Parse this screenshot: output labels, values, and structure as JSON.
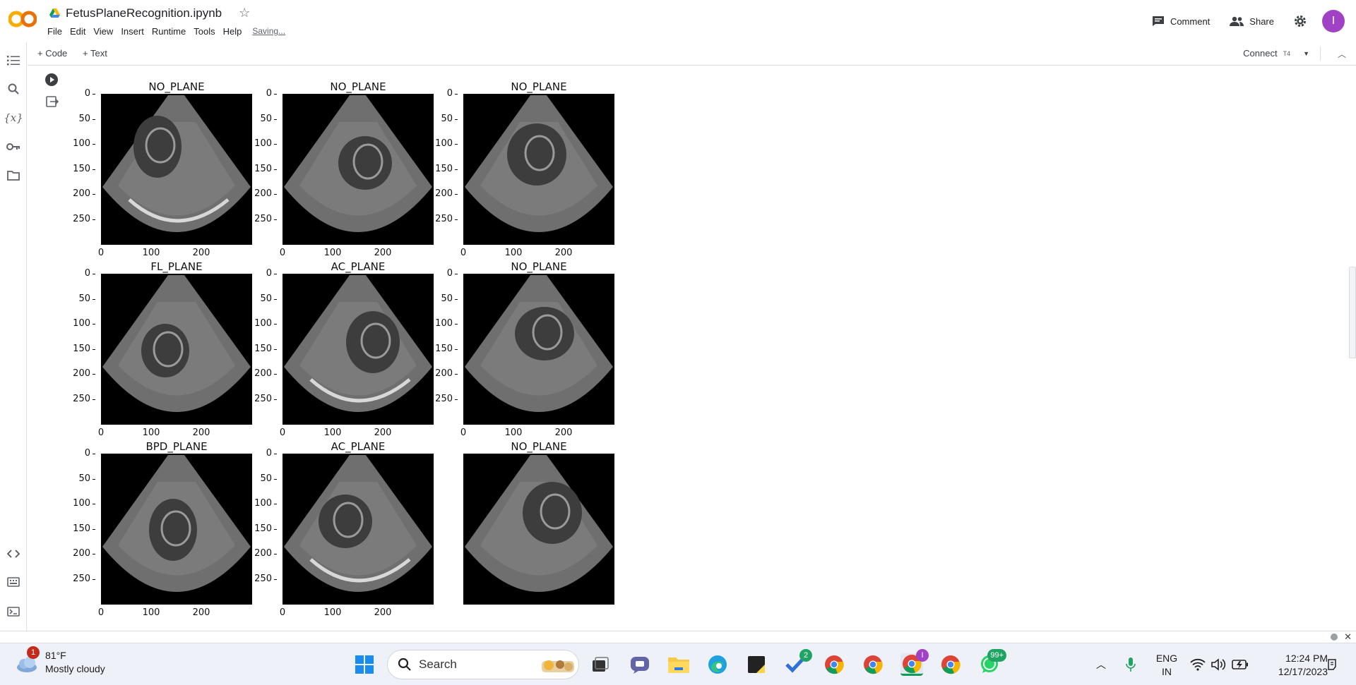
{
  "header": {
    "notebook_title": "FetusPlaneRecognition.ipynb",
    "menu": [
      "File",
      "Edit",
      "View",
      "Insert",
      "Runtime",
      "Tools",
      "Help"
    ],
    "saving_status": "Saving...",
    "comment_label": "Comment",
    "share_label": "Share",
    "avatar_initial": "I"
  },
  "toolbar": {
    "add_code_label": "+ Code",
    "add_text_label": "+ Text",
    "connect_label": "Connect",
    "connect_badge": "T4"
  },
  "plots": [
    {
      "title": "NO_PLANE"
    },
    {
      "title": "NO_PLANE"
    },
    {
      "title": "NO_PLANE"
    },
    {
      "title": "FL_PLANE"
    },
    {
      "title": "AC_PLANE"
    },
    {
      "title": "NO_PLANE"
    },
    {
      "title": "BPD_PLANE"
    },
    {
      "title": "AC_PLANE"
    },
    {
      "title": "NO_PLANE"
    }
  ],
  "axis_ticks": {
    "y": [
      "0",
      "50",
      "100",
      "150",
      "200",
      "250"
    ],
    "x": [
      "0",
      "100",
      "200"
    ]
  },
  "taskbar": {
    "weather_temp": "81°F",
    "weather_desc": "Mostly cloudy",
    "weather_badge": "1",
    "search_label": "Search",
    "todo_badge": "2",
    "whatsapp_badge": "99+",
    "chrome_profile_badge": "I",
    "lang_line1": "ENG",
    "lang_line2": "IN",
    "time": "12:24 PM",
    "date": "12/17/2023"
  }
}
